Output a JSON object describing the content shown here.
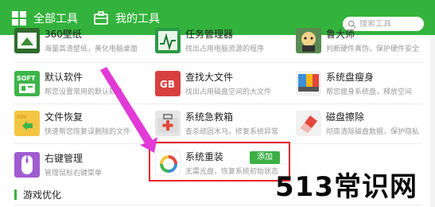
{
  "header": {
    "tab_all": "全部工具",
    "tab_mine": "我的工具",
    "search_placeholder": "搜索工具",
    "bg_color": "#33b33d"
  },
  "tools_row0": [
    {
      "name": "360壁纸",
      "desc": "海量高清壁纸，美化电脑桌面",
      "icon": "wallpaper-icon"
    },
    {
      "name": "任务管理器",
      "desc": "找出占用电脑资源的程序",
      "icon": "task-manager-icon"
    },
    {
      "name": "鲁大师",
      "desc": "判断硬件真伪，保护硬件安全",
      "icon": "ludashi-icon"
    }
  ],
  "tools_row1": [
    {
      "name": "默认软件",
      "desc": "帮您设置常用的默认软件",
      "icon": "default-software-icon"
    },
    {
      "name": "查找大文件",
      "desc": "找出占用磁盘空间的大文件",
      "icon": "gb-file-icon"
    },
    {
      "name": "系统盘瘦身",
      "desc": "帮您瘦身系统盘，释放空间",
      "icon": "disk-slim-icon"
    }
  ],
  "tools_row2": [
    {
      "name": "文件恢复",
      "desc": "快速帮您恢复误删除的文件",
      "icon": "file-recovery-icon"
    },
    {
      "name": "系统急救箱",
      "desc": "查杀顽固木马，修复系统异常",
      "icon": "first-aid-icon"
    },
    {
      "name": "磁盘擦除",
      "desc": "彻底清除磁盘数据，保护隐私",
      "icon": "disk-erase-icon"
    }
  ],
  "tools_row3": [
    {
      "name": "右键管理",
      "desc": "管理鼠标右键菜单",
      "icon": "right-click-icon"
    },
    {
      "name": "系统重装",
      "desc": "无需光盘，恢复系统初始状态",
      "icon": "system-reinstall-icon",
      "action": "添加"
    }
  ],
  "section": {
    "title": "游戏优化"
  },
  "watermark": "513常识网",
  "colors": {
    "accent": "#33b33d",
    "highlight": "#e8262b",
    "arrow": "#e23ad6"
  }
}
